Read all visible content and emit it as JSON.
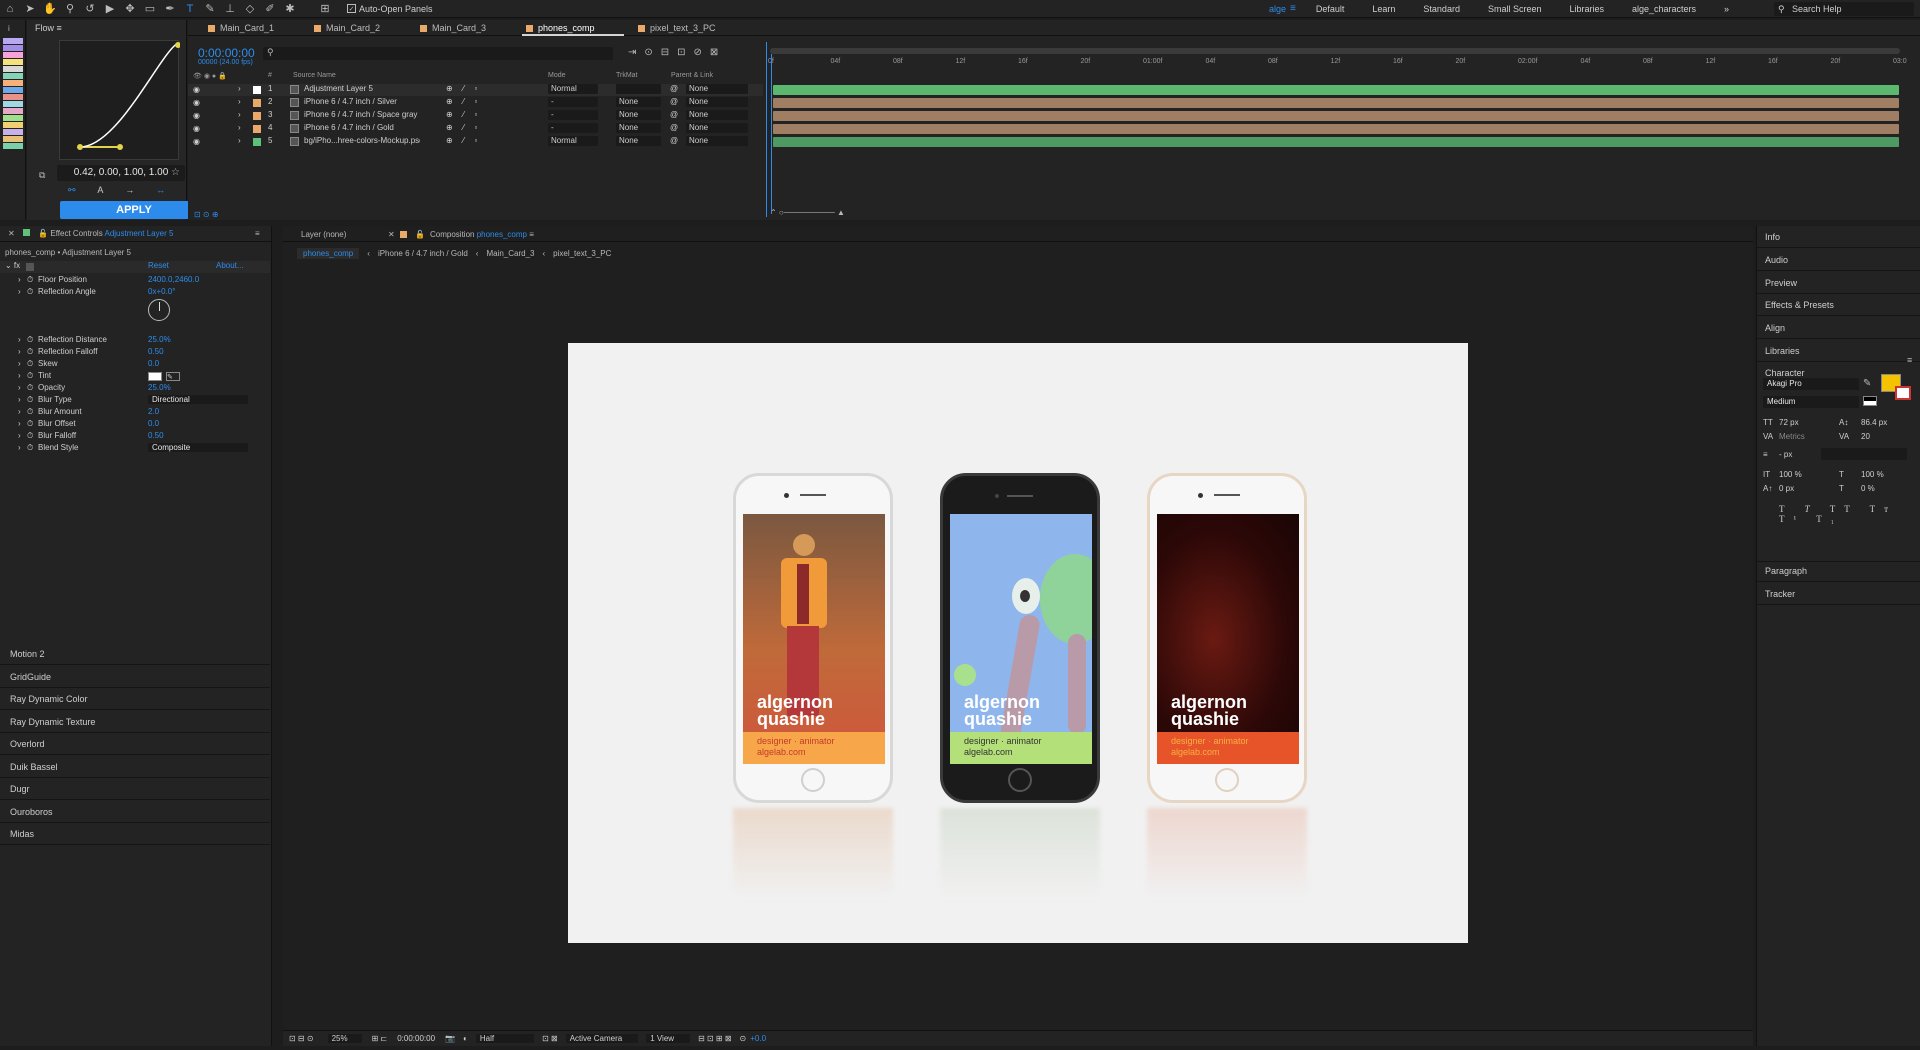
{
  "toolbar": {
    "auto_open_label": "Auto-Open Panels",
    "workspaces": [
      "alge",
      "Default",
      "Learn",
      "Standard",
      "Small Screen",
      "Libraries",
      "alge_characters"
    ],
    "search_placeholder": "Search Help"
  },
  "flow": {
    "title": "Flow",
    "bezier_value": "0.42, 0.00, 1.00, 1.00",
    "apply_label": "APPLY"
  },
  "timeline": {
    "tabs": [
      "Main_Card_1",
      "Main_Card_2",
      "Main_Card_3",
      "phones_comp",
      "pixel_text_3_PC"
    ],
    "timecode": "0:00:00:00",
    "fps": "00000 (24.00 fps)",
    "columns": {
      "source": "Source Name",
      "mode": "Mode",
      "trkmat": "TrkMat",
      "parent": "Parent & Link"
    },
    "layers": [
      {
        "num": "1",
        "name": "Adjustment Layer 5",
        "mode": "Normal",
        "trkmat": "",
        "parent": "None",
        "color": "#ffffff"
      },
      {
        "num": "2",
        "name": "iPhone 6 / 4.7 inch / Silver",
        "mode": "-",
        "trkmat": "None",
        "parent": "None",
        "color": "#e8a96b"
      },
      {
        "num": "3",
        "name": "iPhone 6 / 4.7 inch / Space gray",
        "mode": "-",
        "trkmat": "None",
        "parent": "None",
        "color": "#e8a96b"
      },
      {
        "num": "4",
        "name": "iPhone 6 / 4.7 inch / Gold",
        "mode": "-",
        "trkmat": "None",
        "parent": "None",
        "color": "#e8a96b"
      },
      {
        "num": "5",
        "name": "bg/iPho...hree-colors-Mockup.psd",
        "mode": "Normal",
        "trkmat": "None",
        "parent": "None",
        "color": "#5ec27a"
      }
    ],
    "ruler_ticks": [
      "0f",
      "04f",
      "08f",
      "12f",
      "16f",
      "20f",
      "01:00f",
      "04f",
      "08f",
      "12f",
      "16f",
      "20f",
      "02:00f",
      "04f",
      "08f",
      "12f",
      "16f",
      "20f",
      "03:0"
    ],
    "bar_colors": [
      "#5cb86e",
      "#a07e63",
      "#a07e63",
      "#a07e63",
      "#4e9a63"
    ]
  },
  "effect_controls": {
    "title_prefix": "Effect Controls",
    "title_layer": "Adjustment Layer 5",
    "context": "phones_comp • Adjustment Layer 5",
    "reset": "Reset",
    "about": "About...",
    "params": [
      {
        "label": "Floor Position",
        "value": "2400.0,2460.0"
      },
      {
        "label": "Reflection Angle",
        "value": "0x+0.0°"
      },
      {
        "label": "Reflection Distance",
        "value": "25.0%"
      },
      {
        "label": "Reflection Falloff",
        "value": "0.50"
      },
      {
        "label": "Skew",
        "value": "0.0"
      },
      {
        "label": "Tint",
        "value": ""
      },
      {
        "label": "Opacity",
        "value": "25.0%"
      },
      {
        "label": "Blur Type",
        "value": "Directional"
      },
      {
        "label": "Blur Amount",
        "value": "2.0"
      },
      {
        "label": "Blur Offset",
        "value": "0.0"
      },
      {
        "label": "Blur Falloff",
        "value": "0.50"
      },
      {
        "label": "Blend Style",
        "value": "Composite"
      }
    ],
    "extensions": [
      "Motion 2",
      "GridGuide",
      "Ray Dynamic Color",
      "Ray Dynamic Texture",
      "Overlord",
      "Duik Bassel",
      "Dugr",
      "Ouroboros",
      "Midas"
    ]
  },
  "viewer": {
    "layer_tab": "Layer (none)",
    "comp_tab_prefix": "Composition",
    "comp_tab_name": "phones_comp",
    "breadcrumbs": [
      "phones_comp",
      "iPhone 6 / 4.7 inch / Gold",
      "Main_Card_3",
      "pixel_text_3_PC"
    ],
    "card_name_line1": "algernon",
    "card_name_line2": "quashie",
    "card_role": "designer · animator",
    "card_site": "algelab.com",
    "bottom": {
      "zoom": "25%",
      "timecode": "0:00:00:00",
      "resolution": "Half",
      "camera": "Active Camera",
      "views": "1 View",
      "exposure": "+0.0"
    }
  },
  "right_panels": {
    "items": [
      "Info",
      "Audio",
      "Preview",
      "Effects & Presets",
      "Align",
      "Libraries",
      "Character",
      "Paragraph",
      "Tracker"
    ],
    "character": {
      "font": "Akagi Pro",
      "style": "Medium",
      "size": "72 px",
      "leading": "86.4 px",
      "kerning": "Metrics",
      "tracking": "20",
      "stroke": "- px",
      "vscale": "100 %",
      "hscale": "100 %",
      "baseline": "0 px",
      "tsume": "0 %",
      "fill_color": "#f5c200"
    }
  }
}
